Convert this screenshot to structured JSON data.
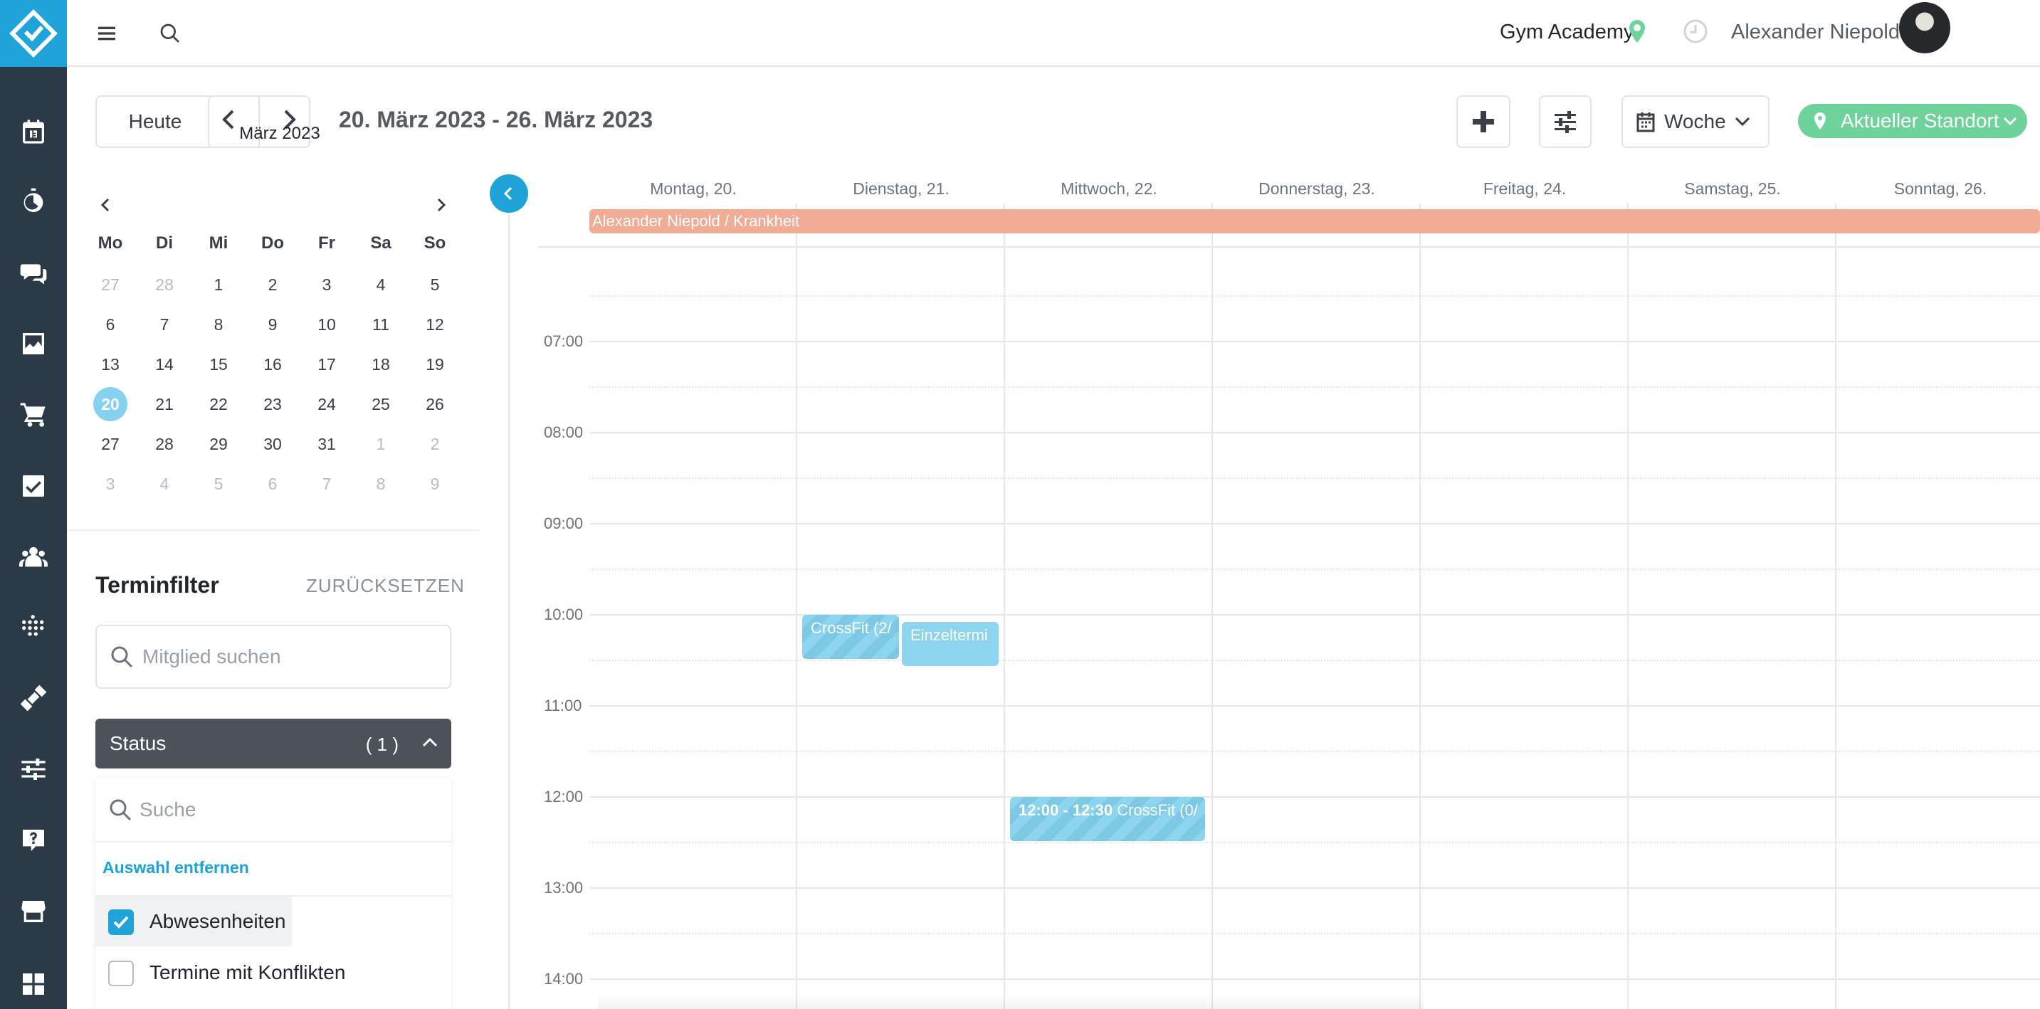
{
  "topbar": {
    "studio_name": "Gym Academy",
    "user_name": "Alexander Niepold"
  },
  "toolbar": {
    "today_label": "Heute",
    "date_range": "20. März 2023 - 26. März 2023",
    "view_label": "Woche",
    "location_label": "Aktueller Standort"
  },
  "mini_calendar": {
    "title": "März 2023",
    "weekdays": [
      "Mo",
      "Di",
      "Mi",
      "Do",
      "Fr",
      "Sa",
      "So"
    ],
    "weeks": [
      [
        "27",
        "28",
        "1",
        "2",
        "3",
        "4",
        "5"
      ],
      [
        "6",
        "7",
        "8",
        "9",
        "10",
        "11",
        "12"
      ],
      [
        "13",
        "14",
        "15",
        "16",
        "17",
        "18",
        "19"
      ],
      [
        "20",
        "21",
        "22",
        "23",
        "24",
        "25",
        "26"
      ],
      [
        "27",
        "28",
        "29",
        "30",
        "31",
        "1",
        "2"
      ],
      [
        "3",
        "4",
        "5",
        "6",
        "7",
        "8",
        "9"
      ]
    ],
    "selected_day": "20"
  },
  "filter": {
    "title": "Terminfilter",
    "reset_label": "ZURÜCKSETZEN",
    "member_search_placeholder": "Mitglied suchen",
    "status_label": "Status",
    "status_count": "( 1 )",
    "status_search_placeholder": "Suche",
    "clear_selection_label": "Auswahl entfernen",
    "options": [
      {
        "label": "Abwesenheiten",
        "checked": true
      },
      {
        "label": "Termine mit Konflikten",
        "checked": false
      }
    ]
  },
  "calendar": {
    "days": [
      "Montag, 20.",
      "Dienstag, 21.",
      "Mittwoch, 22.",
      "Donnerstag, 23.",
      "Freitag, 24.",
      "Samstag, 25.",
      "Sonntag, 26."
    ],
    "allday_event": "Alexander Niepold / Krankheit",
    "hours": [
      "07:00",
      "08:00",
      "09:00",
      "10:00",
      "11:00",
      "12:00",
      "13:00",
      "14:00"
    ],
    "events": [
      {
        "title": "CrossFit (2/",
        "day": "Dienstag, 21."
      },
      {
        "title": "Einzeltermi",
        "day": "Dienstag, 21."
      },
      {
        "time": "12:00 - 12:30",
        "title": "CrossFit (0/",
        "day": "Mittwoch, 22."
      }
    ]
  },
  "colors": {
    "sidebar_bg": "#2c3a47",
    "brand": "#1fa3d8",
    "location_green": "#6ed39b",
    "absence_bar": "#f0ac94",
    "event_blue": "#8dd4ee"
  },
  "icons": {
    "sidebar": [
      "dashboard-icon",
      "calendar-icon",
      "timer-icon",
      "chat-icon",
      "image-icon",
      "cart-icon",
      "task-check-icon",
      "members-icon",
      "dots-grid-icon",
      "dumbbell-icon",
      "sliders-icon",
      "help-icon",
      "shop-icon",
      "apps-icon"
    ],
    "topbar": [
      "menu-icon",
      "search-icon",
      "location-pin-icon",
      "clock-icon"
    ]
  }
}
